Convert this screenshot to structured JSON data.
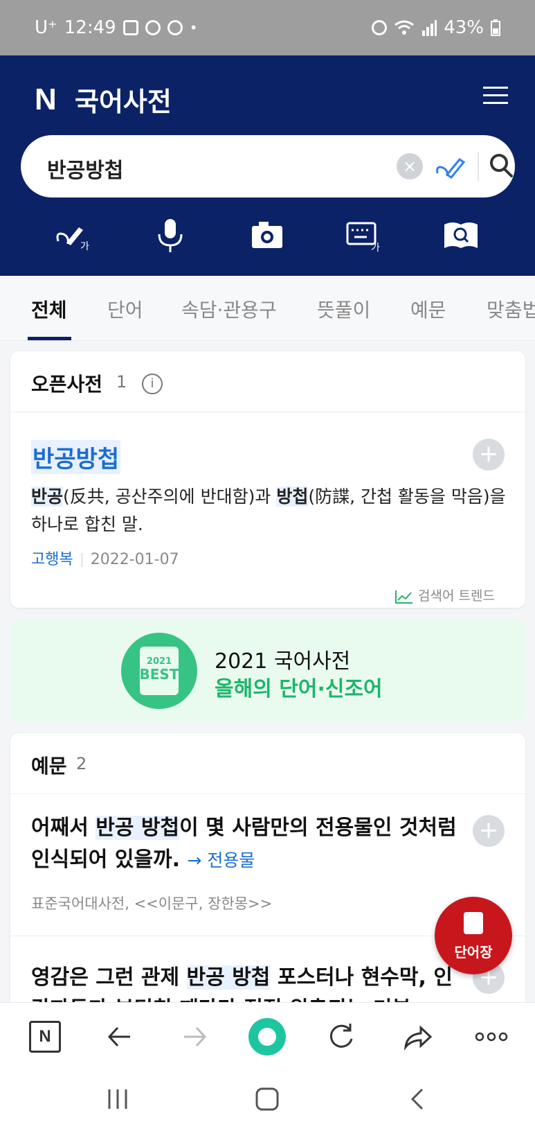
{
  "status_bar": {
    "carrier": "U⁺",
    "time": "12:49",
    "dot": "•",
    "battery": "43%"
  },
  "header": {
    "logo": "N",
    "title": "국어사전"
  },
  "search": {
    "query": "반공방첩",
    "clear_symbol": "×"
  },
  "tabs": [
    "전체",
    "단어",
    "속담·관용구",
    "뜻풀이",
    "예문",
    "맞춤법"
  ],
  "open_dict": {
    "title": "오픈사전",
    "count": "1",
    "info_symbol": "i",
    "entry": {
      "word": "반공방첩",
      "def_a": "반공",
      "def_b": "(反共, 공산주의에 반대함)과 ",
      "def_c": "방첩",
      "def_d": "(防諜, 간첩 활동을 막음)을 하나로 합친 말.",
      "author": "고행복",
      "date": "2022-01-07"
    },
    "trend_label": "검색어 트렌드"
  },
  "banner": {
    "badge_year": "2021",
    "badge_text": "BEST",
    "line1": "2021 국어사전",
    "line2": "올해의 단어·신조어"
  },
  "examples": {
    "title": "예문",
    "count": "2",
    "items": [
      {
        "pre": "어째서 ",
        "hl": "반공 방첩",
        "post": "이 몇 사람만의 전용물인 것처럼 인식되어 있을까. ",
        "link": "→ 전용물",
        "source": "표준국어대사전, <<이문구, 장한몽>>"
      },
      {
        "pre": "영감은 그런 관제 ",
        "hl": "반공 방첩",
        "post": " 포스터나 현수막, 인감파들과 부딪칠 때마다 점점 위축되는 기분"
      }
    ]
  },
  "fab": {
    "label": "단어장"
  },
  "bottom_bar": {
    "n_label": "N"
  },
  "plus_symbol": "+"
}
